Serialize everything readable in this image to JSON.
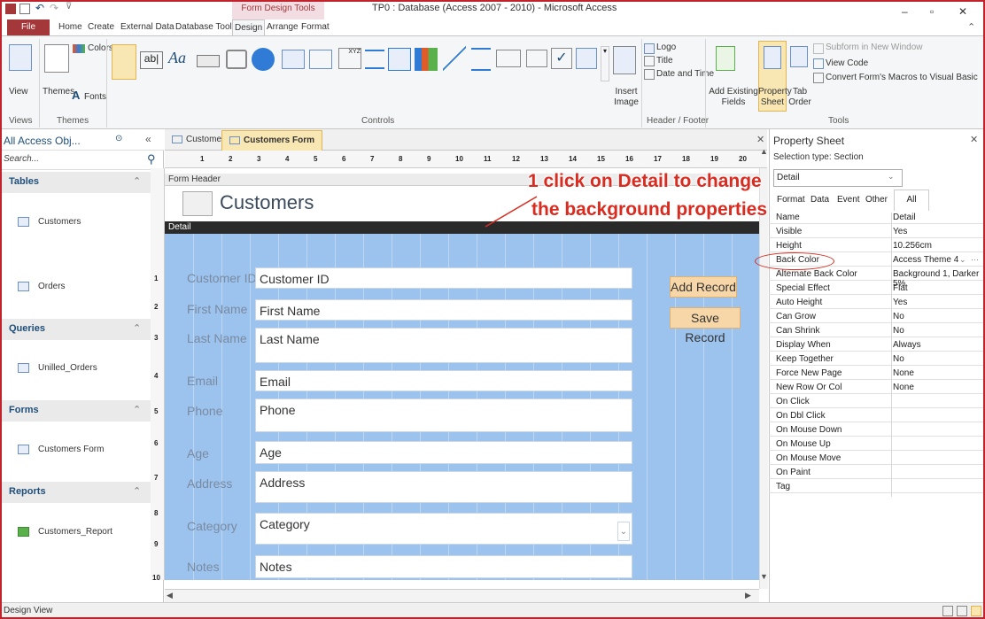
{
  "title_bar": {
    "context_tab": "Form Design Tools",
    "window_title": "TP0 : Database (Access 2007 - 2010) - Microsoft Access"
  },
  "ribbon_tabs": [
    "File",
    "Home",
    "Create",
    "External Data",
    "Database Tools",
    "Design",
    "Arrange",
    "Format"
  ],
  "ribbon": {
    "views_label": "View",
    "themes_label": "Themes",
    "colors_label": "Colors",
    "fonts_label": "Fonts",
    "insert_image_label": "Insert Image",
    "logo_label": "Logo",
    "title_label": "Title",
    "date_time_label": "Date and Time",
    "add_fields_label": "Add Existing Fields",
    "property_sheet_label": "Property Sheet",
    "tab_order_label": "Tab Order",
    "subform_label": "Subform in New Window",
    "view_code_label": "View Code",
    "convert_macros_label": "Convert Form's Macros to Visual Basic",
    "groups": {
      "views": "Views",
      "themes": "Themes",
      "controls": "Controls",
      "header_footer": "Header / Footer",
      "tools": "Tools"
    }
  },
  "nav": {
    "header": "All Access Obj...",
    "search_placeholder": "Search...",
    "sections": [
      {
        "title": "Tables",
        "items": [
          "Customers",
          "Orders"
        ]
      },
      {
        "title": "Queries",
        "items": [
          "Unilled_Orders"
        ]
      },
      {
        "title": "Forms",
        "items": [
          "Customers Form"
        ]
      },
      {
        "title": "Reports",
        "items": [
          "Customers_Report"
        ]
      }
    ]
  },
  "doc_tabs": [
    "Customers",
    "Customers Form"
  ],
  "ruler_numbers": [
    "1",
    "2",
    "3",
    "4",
    "5",
    "6",
    "7",
    "8",
    "9",
    "10",
    "11",
    "12",
    "13",
    "14",
    "15",
    "16",
    "17",
    "18",
    "19",
    "20"
  ],
  "vruler_numbers": [
    "1",
    "2",
    "3",
    "4",
    "5",
    "6",
    "7",
    "8",
    "9",
    "10"
  ],
  "form": {
    "header_label": "Form Header",
    "title": "Customers",
    "detail_label": "Detail",
    "fields": [
      {
        "label": "Customer ID",
        "value": "Customer ID"
      },
      {
        "label": "First Name",
        "value": "First Name"
      },
      {
        "label": "Last Name",
        "value": "Last Name"
      },
      {
        "label": "Email",
        "value": "Email"
      },
      {
        "label": "Phone",
        "value": "Phone"
      },
      {
        "label": "Age",
        "value": "Age"
      },
      {
        "label": "Address",
        "value": "Address"
      },
      {
        "label": "Category",
        "value": "Category"
      },
      {
        "label": "Notes",
        "value": "Notes"
      }
    ],
    "add_button": "Add Record",
    "save_button": "Save Record"
  },
  "annotation": {
    "line1": "1 click on Detail to change",
    "line2": "the background properties"
  },
  "property_sheet": {
    "title": "Property Sheet",
    "selection_type": "Selection type: Section",
    "selected": "Detail",
    "tabs": [
      "Format",
      "Data",
      "Event",
      "Other",
      "All"
    ],
    "rows": [
      {
        "name": "Name",
        "value": "Detail"
      },
      {
        "name": "Visible",
        "value": "Yes"
      },
      {
        "name": "Height",
        "value": "10.256cm"
      },
      {
        "name": "Back Color",
        "value": "Access Theme 4"
      },
      {
        "name": "Alternate Back Color",
        "value": "Background 1, Darker 5%"
      },
      {
        "name": "Special Effect",
        "value": "Flat"
      },
      {
        "name": "Auto Height",
        "value": "Yes"
      },
      {
        "name": "Can Grow",
        "value": "No"
      },
      {
        "name": "Can Shrink",
        "value": "No"
      },
      {
        "name": "Display When",
        "value": "Always"
      },
      {
        "name": "Keep Together",
        "value": "No"
      },
      {
        "name": "Force New Page",
        "value": "None"
      },
      {
        "name": "New Row Or Col",
        "value": "None"
      },
      {
        "name": "On Click",
        "value": ""
      },
      {
        "name": "On Dbl Click",
        "value": ""
      },
      {
        "name": "On Mouse Down",
        "value": ""
      },
      {
        "name": "On Mouse Up",
        "value": ""
      },
      {
        "name": "On Mouse Move",
        "value": ""
      },
      {
        "name": "On Paint",
        "value": ""
      },
      {
        "name": "Tag",
        "value": ""
      }
    ]
  },
  "status": {
    "text": "Design View"
  },
  "colors": {
    "accent": "#a4373a",
    "detail_bg": "#9cc3ee",
    "annotation": "#d92b1f"
  }
}
